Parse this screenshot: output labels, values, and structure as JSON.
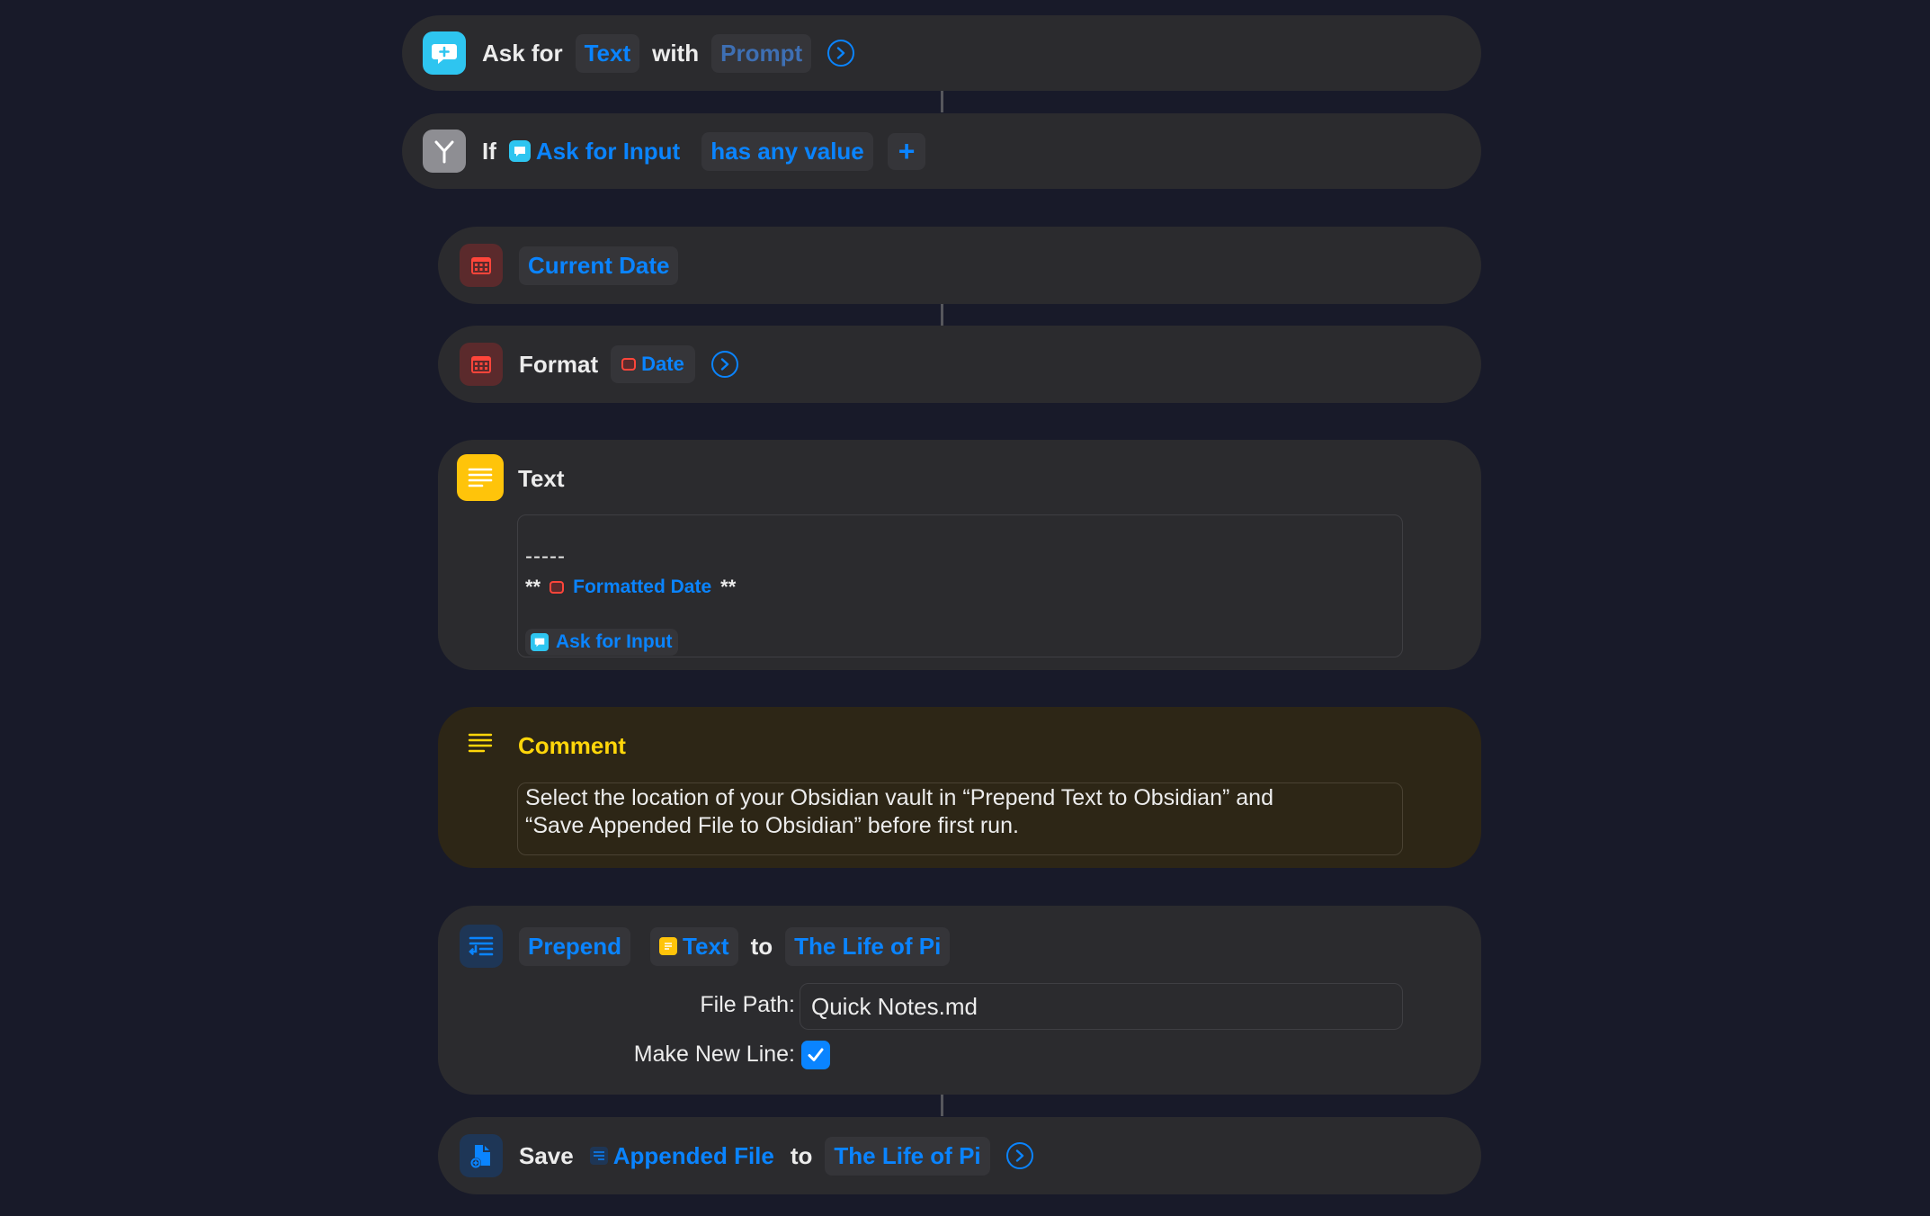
{
  "ask": {
    "label": "Ask for",
    "type_token": "Text",
    "with_label": "with",
    "prompt_token": "Prompt"
  },
  "if_block": {
    "label": "If",
    "input_token": "Ask for Input",
    "condition_token": "has any value",
    "add_symbol": "+"
  },
  "current_date": {
    "token": "Current Date"
  },
  "format": {
    "label": "Format",
    "date_token": "Date"
  },
  "text_action": {
    "title": "Text",
    "line_dashes": "-----",
    "bold_open": "**",
    "formatted_date_token": "Formatted Date",
    "bold_close": "**",
    "input_token": "Ask for Input"
  },
  "comment": {
    "title": "Comment",
    "line1": "Select the location of your Obsidian vault in “Prepend Text to Obsidian” and",
    "line2": "“Save Appended File to Obsidian” before first run."
  },
  "prepend": {
    "action_token": "Prepend",
    "text_token": "Text",
    "to_label": "to",
    "target_token": "The Life of Pi",
    "file_path_label": "File Path:",
    "file_path_value": "Quick Notes.md",
    "new_line_label": "Make New Line:",
    "new_line_checked": true
  },
  "save": {
    "label": "Save",
    "file_token": "Appended File",
    "to_label": "to",
    "target_token": "The Life of Pi"
  },
  "colors": {
    "background": "#181a29",
    "card": "#2b2b2e",
    "comment_card": "#2d2616",
    "accent_blue": "#0a84ff",
    "comment_yellow": "#ffd60a",
    "icon_cyan": "#2ec5f0",
    "icon_red": "#ff453a",
    "icon_yellow": "#ffc40a"
  }
}
